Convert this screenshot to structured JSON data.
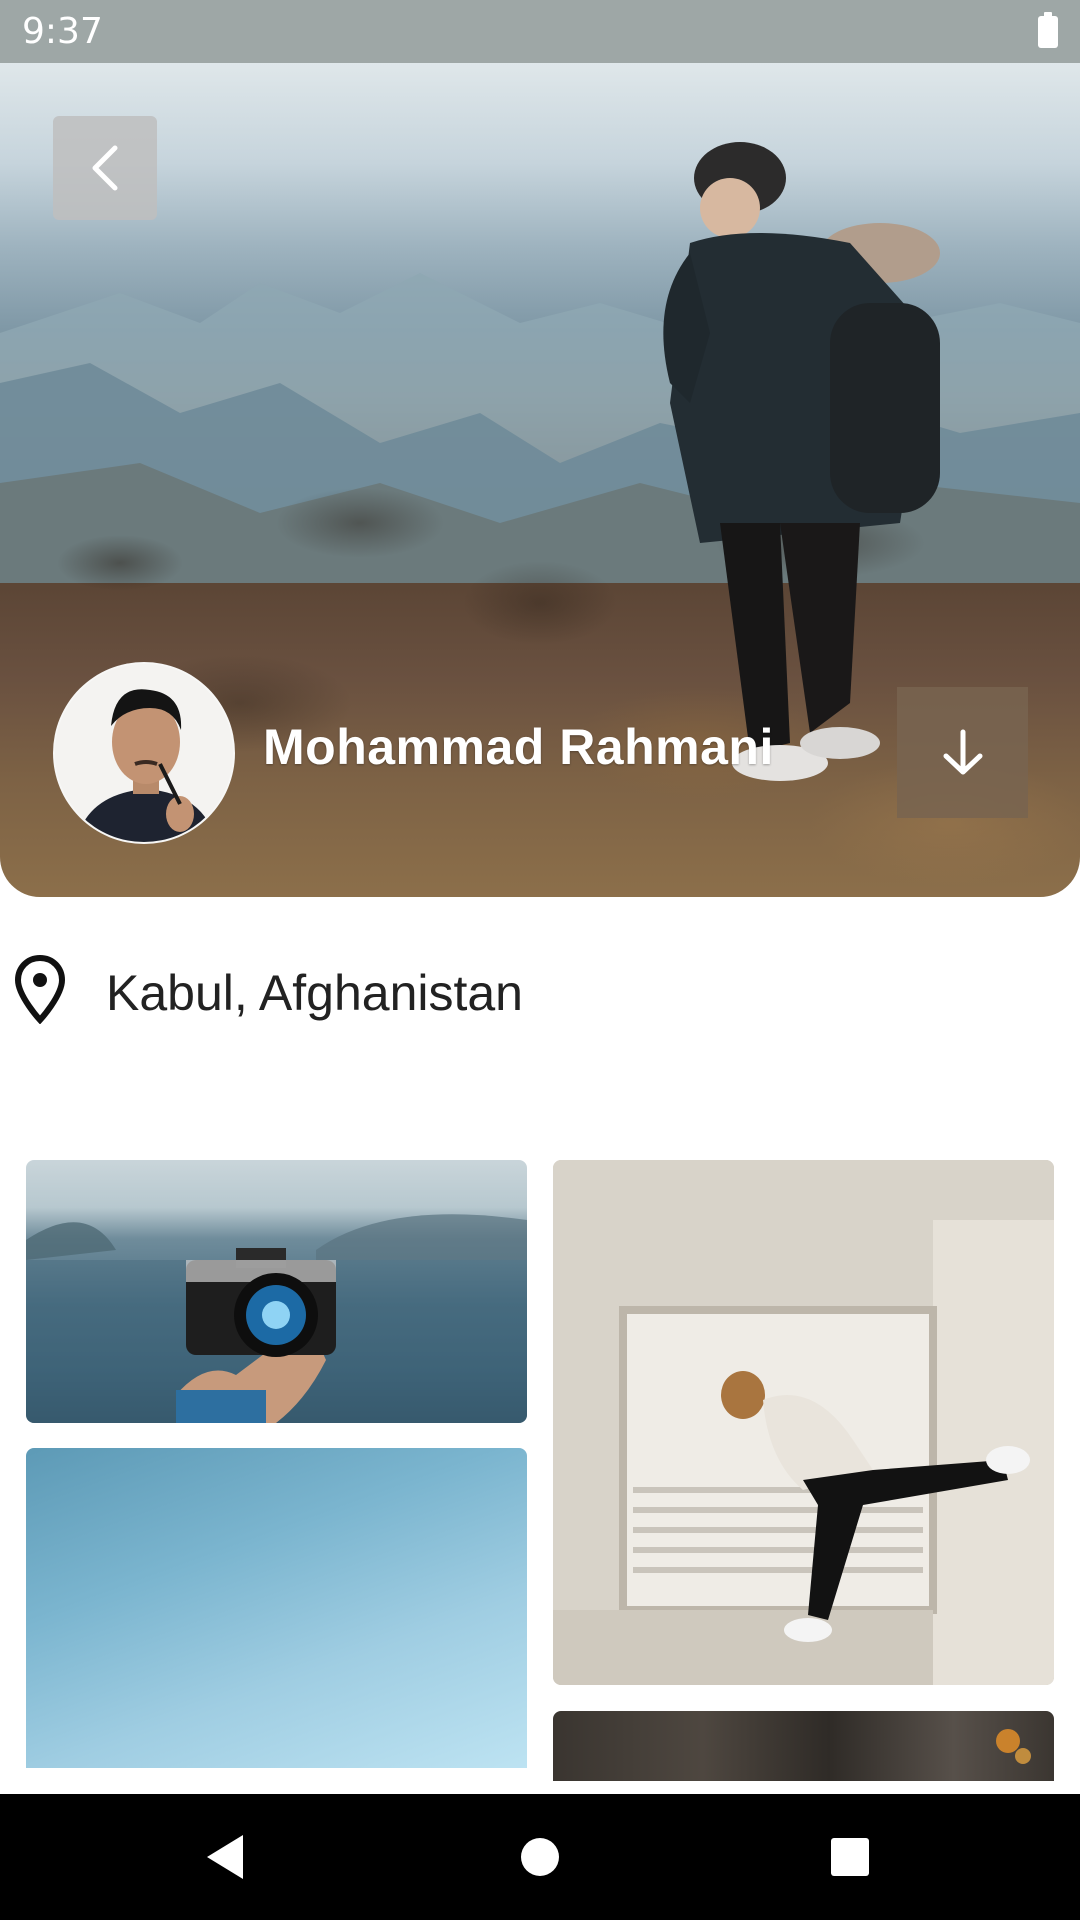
{
  "status_bar": {
    "time": "9:37"
  },
  "profile": {
    "name": "Mohammad Rahmani",
    "location": "Kabul, Afghanistan"
  },
  "icons": {
    "back": "chevron-left-icon",
    "download": "arrow-down-icon",
    "location": "location-pin-icon",
    "battery": "battery-icon",
    "nav_back": "triangle-back-icon",
    "nav_home": "circle-home-icon",
    "nav_recents": "square-recents-icon"
  },
  "colors": {
    "status_bar": "#9ea7a6",
    "nav_bar": "#000000",
    "text_primary": "#222222",
    "name_text": "#ffffff"
  }
}
